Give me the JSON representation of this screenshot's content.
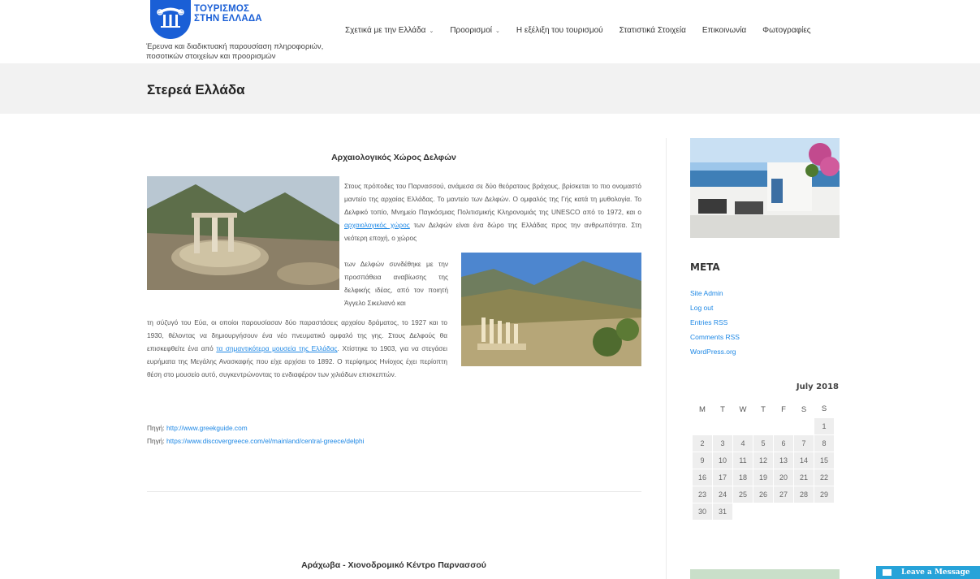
{
  "header": {
    "logo_line1": "ΤΟΥΡΙΣΜΟΣ",
    "logo_line2": "ΣΤΗΝ ΕΛΛΑΔΑ",
    "tagline": "Έρευνα και διαδικτυακή παρουσίαση πληροφοριών, ποσοτικών στοιχείων και προορισμών",
    "nav": [
      {
        "label": "Σχετικά με την Ελλάδα"
      },
      {
        "label": "Προορισμοί"
      },
      {
        "label": "Η εξέλιξη του τουρισμού"
      },
      {
        "label": "Στατιστικά Στοιχεία"
      },
      {
        "label": "Επικοινωνία"
      },
      {
        "label": "Φωτογραφίες"
      }
    ]
  },
  "page": {
    "title": "Στερεά Ελλάδα"
  },
  "article": {
    "title": "Αρχαιολογικός Χώρος Δελφών",
    "p1_a": "Στους πρόποδες του Παρνασσού, ανάμεσα σε δύο θεόρατους βράχους, βρίσκεται το πιο ονομαστό μαντείο της αρχαίας Ελλάδας. Το μαντείο των Δελφών. Ο ομφαλός της Γής κατά τη μυθολογία. Το Δελφικό τοπίο, Μνημείο Παγκόσμιας Πολιτισμικής Κληρονομιάς της UNESCO από το 1972, και ο ",
    "p1_link": "αρχαιολογικός χώρος",
    "p1_b": " των Δελφών είναι ένα δώρο της Ελλάδας προς την ανθρωπότητα. Στη νεότερη εποχή, ο χώρος",
    "p2": "των Δελφών συνδέθηκε με την προσπάθεια αναβίωσης της δελφικής ιδέας, από τον ποιητή Άγγελο Σικελιανό και",
    "p3_a": "τη σύζυγό του Εύα, οι οποίοι παρουσίασαν δύο παραστάσεις αρχαίου δράματος, το 1927 και το 1930, θέλοντας να δημιουργήσουν ένα νέο πνευματικό ομφαλό της γης. Στους Δελφούς θα επισκεφθείτε ένα από ",
    "p3_link": "τα σημαντικότερα μουσεία της Ελλάδας",
    "p3_b": ". Χτίστηκε το 1903, για να στεγάσει ευρήματα της Μεγάλης Ανασκαφής που είχε αρχίσει το 1892. Ο περίφημος Ηνίοχος έχει περίοπτη θέση στο μουσείο αυτό, συγκεντρώνοντας το ενδιαφέρον των χιλιάδων επισκεπτών.",
    "source_label": "Πηγή:",
    "source1": "http://www.greekguide.com",
    "source2": "https://www.discovergreece.com/el/mainland/central-greece/delphi",
    "next_title": "Αράχωβα - Χιονοδρομικό Κέντρο Παρνασσού"
  },
  "sidebar": {
    "meta_title": "META",
    "meta_links": [
      "Site Admin",
      "Log out",
      "Entries RSS",
      "Comments RSS",
      "WordPress.org"
    ],
    "calendar": {
      "caption": "July 2018",
      "weekdays": [
        "M",
        "T",
        "W",
        "T",
        "F",
        "S",
        "S"
      ],
      "weeks": [
        [
          "",
          "",
          "",
          "",
          "",
          "",
          "1"
        ],
        [
          "2",
          "3",
          "4",
          "5",
          "6",
          "7",
          "8"
        ],
        [
          "9",
          "10",
          "11",
          "12",
          "13",
          "14",
          "15"
        ],
        [
          "16",
          "17",
          "18",
          "19",
          "20",
          "21",
          "22"
        ],
        [
          "23",
          "24",
          "25",
          "26",
          "27",
          "28",
          "29"
        ],
        [
          "30",
          "31",
          "",
          "",
          "",
          "",
          ""
        ]
      ]
    }
  },
  "chat": {
    "label": "Leave a Message"
  },
  "colors": {
    "brand": "#1a5fd6",
    "link": "#1e88e5",
    "chat": "#27a3d9"
  }
}
